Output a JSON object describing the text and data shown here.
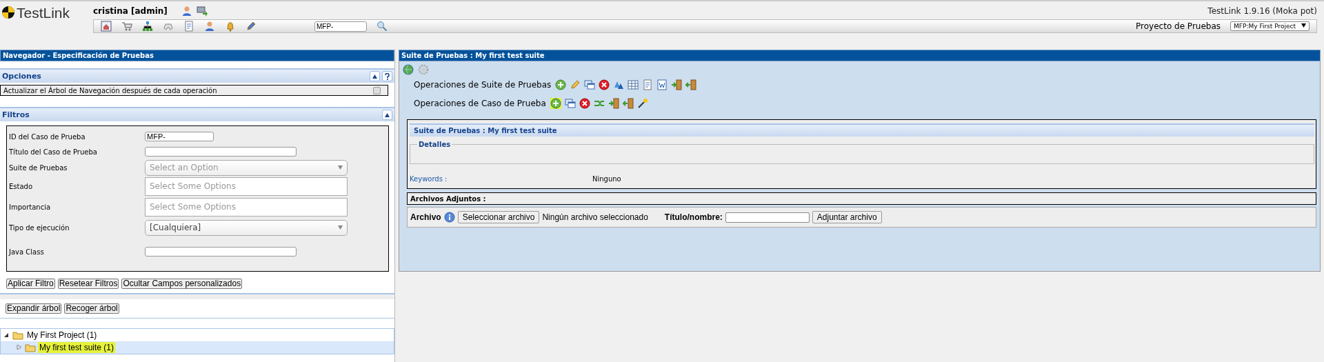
{
  "header": {
    "logo": "TestLink",
    "user": "cristina [admin]",
    "search_value": "MFP-",
    "version": "TestLink 1.9.16 (Moka pot)",
    "project_label": "Proyecto de Pruebas",
    "project_value": "MFP:My First Project"
  },
  "navigator": {
    "title": "Navegador - Especificación de Pruebas",
    "options": {
      "title": "Opciones",
      "expanded": true,
      "items": [
        {
          "label": "Actualizar el Árbol de Navegación después de cada operación",
          "checked": false
        }
      ]
    },
    "filters": {
      "title": "Filtros",
      "expanded": true,
      "fields": [
        {
          "label": "ID del Caso de Prueba",
          "kind": "text",
          "value": "MFP-"
        },
        {
          "label": "Título del Caso de Prueba",
          "kind": "text"
        },
        {
          "label": "Suite de Pruebas",
          "kind": "select",
          "placeholder": "Select an Option"
        },
        {
          "label": "Estado",
          "kind": "multi",
          "placeholder": "Select Some Options"
        },
        {
          "label": "Importancia",
          "kind": "multi",
          "placeholder": "Select Some Options"
        },
        {
          "label": "Tipo de ejecución",
          "kind": "select",
          "value": "[Cualquiera]"
        },
        {
          "label": "Java Class",
          "kind": "text"
        }
      ],
      "buttons": [
        "Aplicar Filtro",
        "Resetear Filtros",
        "Ocultar Campos personalizados"
      ]
    },
    "tree_buttons": [
      "Expandir árbol",
      "Recoger árbol"
    ],
    "tree": [
      {
        "label": "My First Project (1)",
        "expanded": true,
        "selected": false,
        "highlighted": false,
        "children": [
          {
            "label": "My first test suite (1)",
            "expanded": false,
            "selected": true,
            "highlighted": true
          }
        ]
      }
    ]
  },
  "content": {
    "title": "Suite de Pruebas : My first test suite",
    "operation_rows": [
      {
        "label": "Operaciones de Suite de Pruebas",
        "actions": [
          {
            "kind": "add",
            "highlighted": false
          },
          {
            "kind": "edit",
            "highlighted": false
          },
          {
            "kind": "copy",
            "highlighted": false
          },
          {
            "kind": "delete",
            "highlighted": false
          },
          {
            "kind": "reorder",
            "highlighted": false
          },
          {
            "kind": "table",
            "highlighted": false
          },
          {
            "kind": "doc",
            "highlighted": false
          },
          {
            "kind": "word",
            "highlighted": false
          },
          {
            "kind": "import",
            "highlighted": false
          },
          {
            "kind": "export",
            "highlighted": false
          }
        ]
      },
      {
        "label": "Operaciones de Caso de Prueba",
        "actions": [
          {
            "kind": "add",
            "highlighted": true
          },
          {
            "kind": "copy",
            "highlighted": false
          },
          {
            "kind": "delete",
            "highlighted": false
          },
          {
            "kind": "move",
            "highlighted": false
          },
          {
            "kind": "import",
            "highlighted": false
          },
          {
            "kind": "export",
            "highlighted": false
          },
          {
            "kind": "wand",
            "highlighted": false
          }
        ]
      }
    ],
    "suite": {
      "title": "Suite de Pruebas : My first test suite",
      "details_legend": "Detalles",
      "keywords_label": "Keywords :",
      "keywords_value": "Ninguno"
    },
    "attachments_title": "Archivos Adjuntos :",
    "upload": {
      "label": "Archivo",
      "choose_button": "Seleccionar archivo",
      "file_status": "Ningún archivo seleccionado",
      "title_label": "Título/nombre:",
      "submit_button": "Adjuntar archivo"
    }
  }
}
